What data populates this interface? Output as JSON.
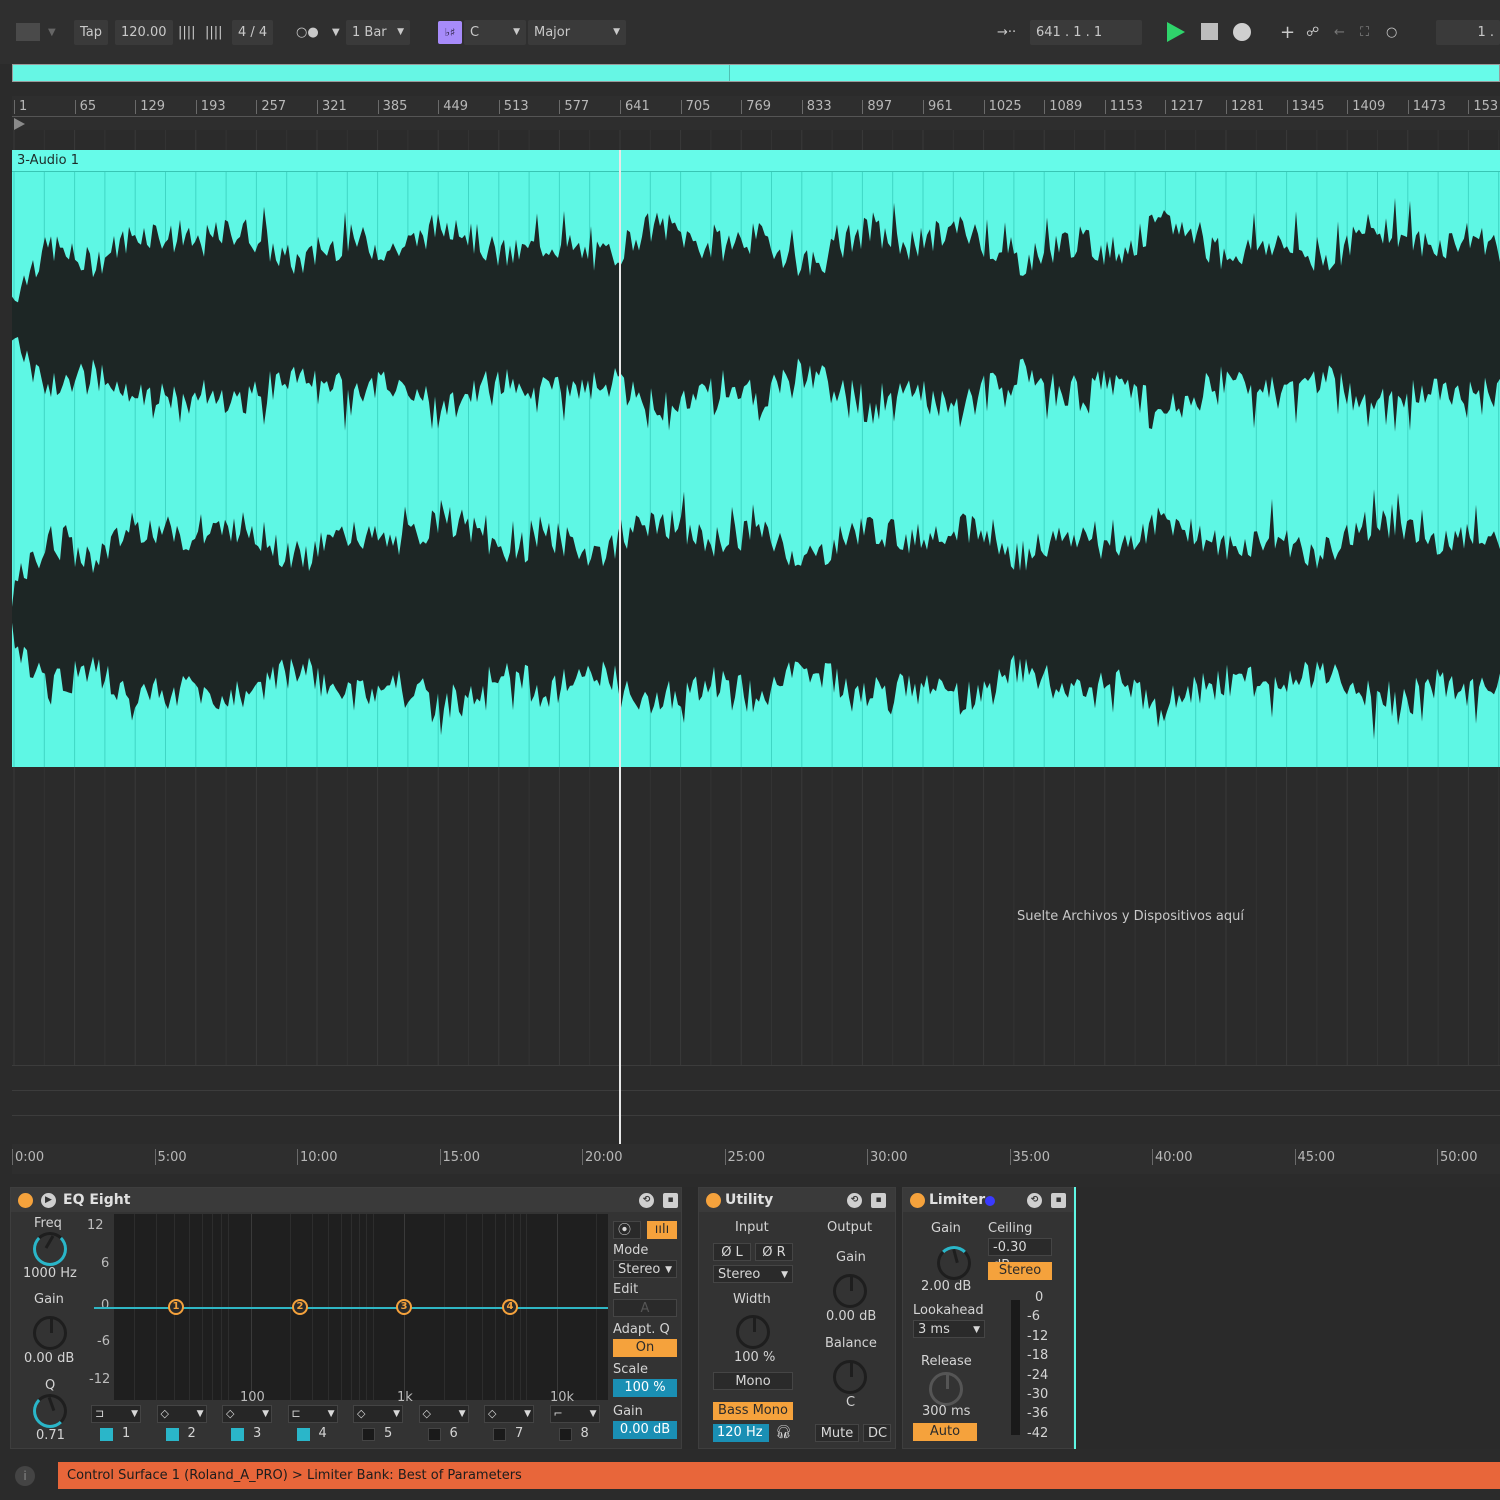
{
  "toolbar": {
    "tap_label": "Tap",
    "tempo": "120.00",
    "time_signature": "4 / 4",
    "metronome_glyph": "○●",
    "quantize": "1 Bar",
    "key_icon": "♭♯",
    "key_root": "C",
    "scale": "Major",
    "position": "641 .   1 .   1",
    "loop_start": "1 ."
  },
  "ruler": {
    "bars": [
      "1",
      "65",
      "129",
      "193",
      "257",
      "321",
      "385",
      "449",
      "513",
      "577",
      "641",
      "705",
      "769",
      "833",
      "897",
      "961",
      "1025",
      "1089",
      "1153",
      "1217",
      "1281",
      "1345",
      "1409",
      "1473",
      "153"
    ]
  },
  "track": {
    "clip_name": "3-Audio 1",
    "drop_hint": "Suelte Archivos y Dispositivos aquí",
    "clip_color": "#5ef7e4"
  },
  "time_ruler": {
    "times": [
      "0:00",
      "5:00",
      "10:00",
      "15:00",
      "20:00",
      "25:00",
      "30:00",
      "35:00",
      "40:00",
      "45:00",
      "50:00"
    ]
  },
  "eq": {
    "title": "EQ Eight",
    "freq_label": "Freq",
    "freq_value": "1000 Hz",
    "gain_label": "Gain",
    "gain_value": "0.00 dB",
    "q_label": "Q",
    "q_value": "0.71",
    "db_ticks": [
      "12",
      "6",
      "0",
      "-6",
      "-12"
    ],
    "hz_ticks": [
      "100",
      "1k",
      "10k"
    ],
    "nodes": [
      "1",
      "2",
      "3",
      "4"
    ],
    "mode_label": "Mode",
    "mode_value": "Stereo",
    "edit_label": "Edit",
    "edit_value": "A",
    "adapt_label": "Adapt. Q",
    "adapt_value": "On",
    "scale_label": "Scale",
    "scale_value": "100 %",
    "out_gain_label": "Gain",
    "out_gain_value": "0.00 dB",
    "bands": [
      "1",
      "2",
      "3",
      "4",
      "5",
      "6",
      "7",
      "8"
    ]
  },
  "utility": {
    "title": "Utility",
    "input_label": "Input",
    "output_label": "Output",
    "phase_l": "Ø L",
    "phase_r": "Ø R",
    "channel_mode": "Stereo",
    "width_label": "Width",
    "width_value": "100 %",
    "mono_label": "Mono",
    "bass_mono_label": "Bass Mono",
    "bass_freq": "120 Hz",
    "gain_label": "Gain",
    "gain_value": "0.00 dB",
    "balance_label": "Balance",
    "balance_value": "C",
    "mute_label": "Mute",
    "dc_label": "DC"
  },
  "limiter": {
    "title": "Limiter",
    "gain_label": "Gain",
    "gain_value": "2.00 dB",
    "ceiling_label": "Ceiling",
    "ceiling_value": "-0.30 dB",
    "stereo_label": "Stereo",
    "lookahead_label": "Lookahead",
    "lookahead_value": "3 ms",
    "release_label": "Release",
    "release_value": "300 ms",
    "auto_label": "Auto",
    "meter_scale": [
      "0",
      "-6",
      "-12",
      "-18",
      "-24",
      "-30",
      "-36",
      "-42"
    ]
  },
  "status": {
    "message": "Control Surface 1 (Roland_A_PRO) > Limiter Bank: Best of Parameters",
    "info_icon": "i"
  }
}
